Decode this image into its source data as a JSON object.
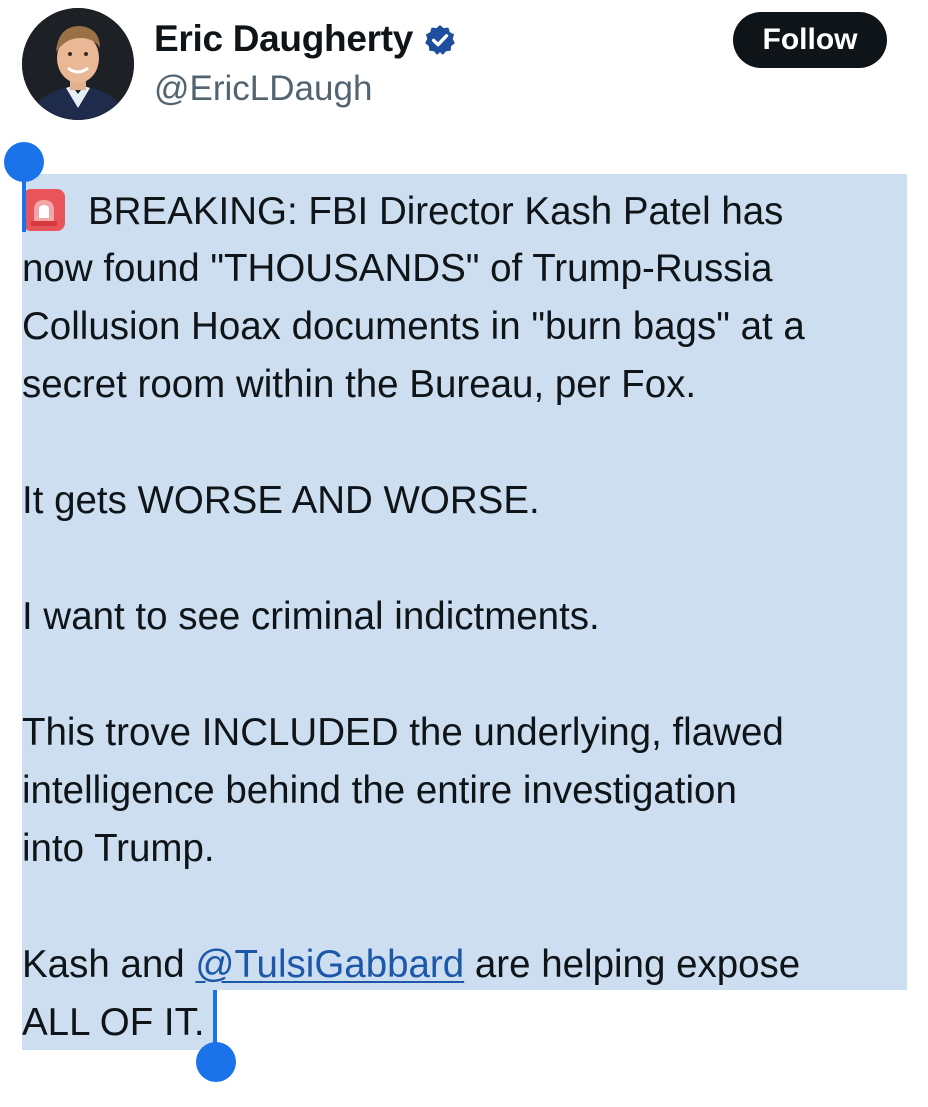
{
  "author": {
    "display_name": "Eric Daugherty",
    "handle": "@EricLDaugh",
    "verified": true,
    "avatar_icon": "profile-photo"
  },
  "actions": {
    "follow_label": "Follow"
  },
  "tweet": {
    "emoji_icon": "police-siren-emoji",
    "lines": [
      "BREAKING: FBI Director Kash Patel has",
      "now found \"THOUSANDS\" of Trump-Russia",
      "Collusion Hoax documents in \"burn bags\" at a",
      "secret room within the Bureau, per Fox.",
      "It gets WORSE AND WORSE.",
      "I want to see criminal indictments.",
      "This trove INCLUDED the underlying, flawed",
      "intelligence behind the entire investigation",
      "into Trump.",
      "Kash and ",
      "@TulsiGabbard",
      " are helping expose",
      "ALL OF IT."
    ]
  },
  "colors": {
    "selection": "#ccdeef",
    "selection_handle": "#1a73e8",
    "verified_badge": "#1d4f9e",
    "follow_button_bg": "#0f1419",
    "mention": "#1d58a8"
  }
}
